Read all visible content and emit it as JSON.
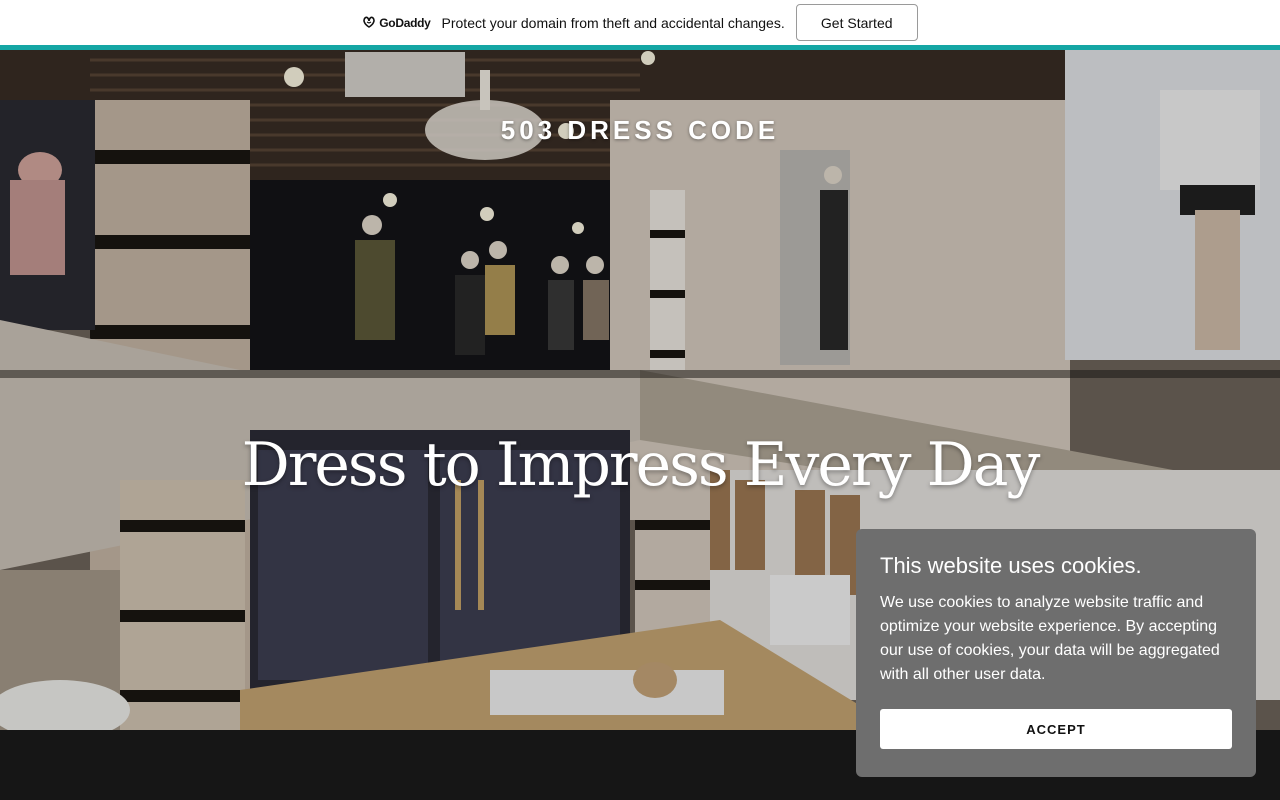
{
  "promo": {
    "brand": "GoDaddy",
    "text": "Protect your domain from theft and accidental changes.",
    "cta_label": "Get Started",
    "accent_color": "#14a6a4"
  },
  "hero": {
    "site_title": "503 DRESS CODE",
    "heading": "Dress to Impress Every Day",
    "background_icon": "store-interior-photo"
  },
  "cookie": {
    "title": "This website uses cookies.",
    "body": "We use cookies to analyze website traffic and optimize your website experience. By accepting our use of cookies, your data will be aggregated with all other user data.",
    "accept_label": "ACCEPT"
  }
}
